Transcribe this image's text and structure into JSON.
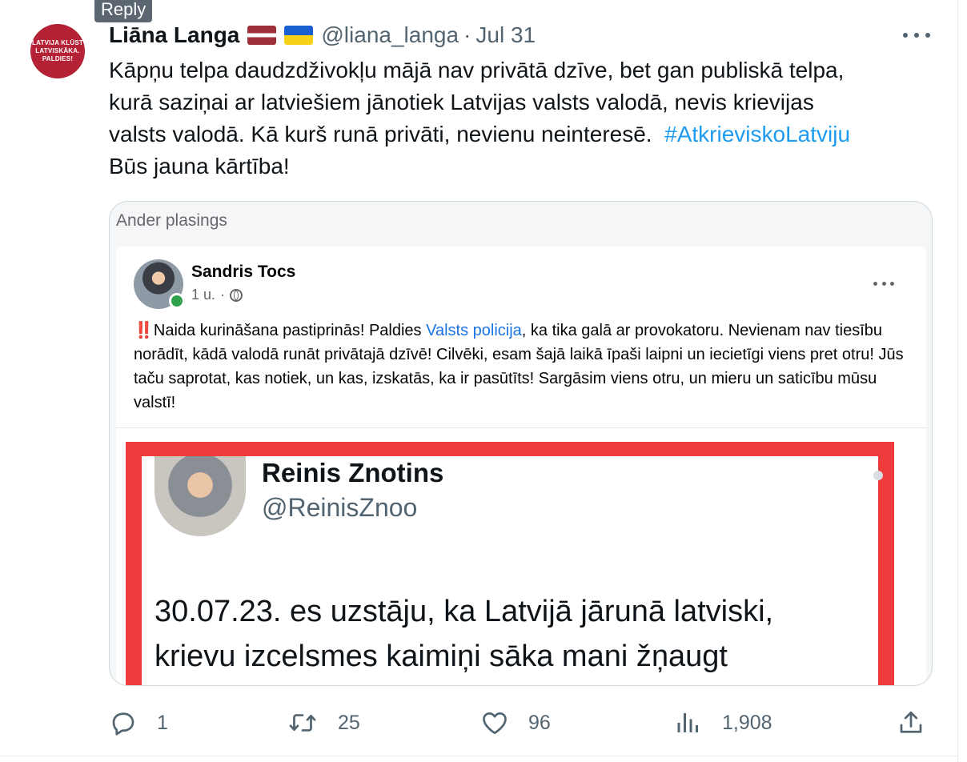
{
  "tooltip": "Reply",
  "author": {
    "avatar_lines": [
      "LATVIJA KLŪST",
      "LATVISKĀKA.",
      "PALDIES!"
    ],
    "name": "Liāna Langa",
    "handle": "@liana_langa",
    "separator": "·",
    "date": "Jul 31",
    "flags": [
      "latvia-flag-icon",
      "ukraine-flag-icon"
    ]
  },
  "tweet": {
    "line1": "Kāpņu telpa daudzdživokļu mājā nav privātā dzīve, bet gan publiskā telpa,",
    "line2": "kurā saziņai ar latviešiem jānotiek Latvijas valsts valodā, nevis krievijas",
    "line3": "valsts valodā. Kā kurš runā privāti, nevienu neinteresē.",
    "hashtag": "#AtkrieviskoLatviju",
    "line4": "Būs jauna kārtība!"
  },
  "card": {
    "label": "Ander plasings",
    "post": {
      "name": "Sandris Tocs",
      "time": "1 u.",
      "meta_separator": "·",
      "bang": "‼️",
      "text_before_link": "Naida kurināšana pastiprinās! Paldies ",
      "link": "Valsts policija",
      "text_after_link": ", ka tika galā ar provokatoru. Nevienam nav tiesību norādīt, kādā valodā runāt privātajā dzīvē! Cilvēki, esam šajā laikā īpaši laipni un iecietīgi viens pret otru! Jūs taču saprotat, kas notiek, un kas, izskatās, ka ir pasūtīts! Sargāsim viens otru, un mieru un saticību mūsu valstī!"
    },
    "embedded": {
      "name": "Reinis Znotins",
      "handle": "@ReinisZnoo",
      "text_line1": "30.07.23. es uzstāju, ka Latvijā jārunā latviski,",
      "text_line2": "krievu izcelsmes kaimiņi sāka mani žņaugt"
    }
  },
  "actions": {
    "replies": "1",
    "retweets": "25",
    "likes": "96",
    "views": "1,908"
  },
  "colors": {
    "accent": "#1d9bf0",
    "secondary_text": "#536471",
    "avatar_red": "#b52135",
    "screenshot_border": "#ee3b3b"
  }
}
